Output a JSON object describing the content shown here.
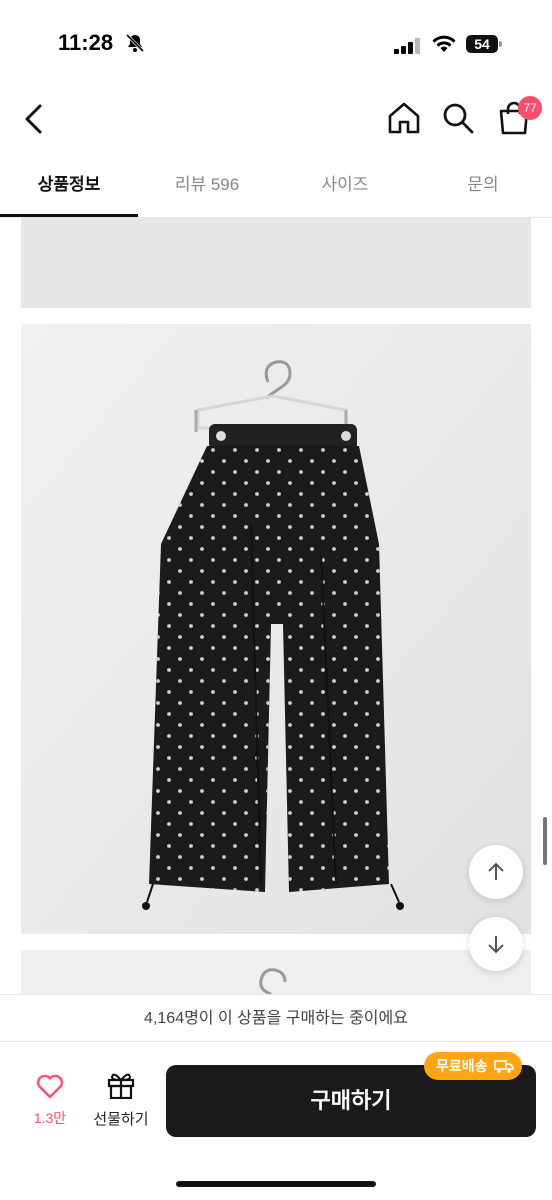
{
  "status_bar": {
    "time": "11:28",
    "battery": "54"
  },
  "nav": {
    "cart_badge": "77"
  },
  "tabs": [
    {
      "label": "상품정보",
      "active": true
    },
    {
      "label": "리뷰 596",
      "active": false
    },
    {
      "label": "사이즈",
      "active": false
    },
    {
      "label": "문의",
      "active": false
    }
  ],
  "notice": {
    "text": "4,164명이 이 상품을 구매하는 중이에요"
  },
  "bottom_bar": {
    "like_count": "1.3만",
    "gift_label": "선물하기",
    "buy_label": "구매하기",
    "free_shipping_label": "무료배송"
  },
  "colors": {
    "accent_pink": "#ff4d6d",
    "badge_orange": "#ffa514",
    "buy_button": "#1a1a1a"
  }
}
